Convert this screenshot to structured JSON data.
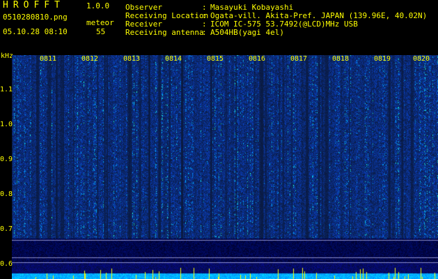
{
  "app": {
    "name": "HROFFT",
    "version": "1.0.0",
    "filename": "0510280810.png",
    "datetime": "05.10.28 08:10"
  },
  "meteor": {
    "label": "meteor",
    "count": "55"
  },
  "info": [
    {
      "label": "Observer",
      "value": "Masayuki Kobayashi"
    },
    {
      "label": "Receiving Location",
      "value": "Ogata-vill. Akita-Pref. JAPAN (139.96E, 40.02N)"
    },
    {
      "label": "Receiver",
      "value": "ICOM IC-575 53.7492(@LCD)MHz USB"
    },
    {
      "label": "Receiving antenna",
      "value": "A504HB(yagi 4el)"
    }
  ],
  "axis": {
    "unit": "kHz",
    "y_ticks": [
      "1.1",
      "1.0",
      "0.9",
      "0.8",
      "0.7",
      "0.6"
    ],
    "x_ticks": [
      "0811",
      "0812",
      "0813",
      "0814",
      "0815",
      "0816",
      "0817",
      "0818",
      "0819",
      "0820"
    ]
  },
  "colors": {
    "text": "#ffff00",
    "background": "#000000",
    "noise": "#1e3cc8",
    "signal": "#00ffff",
    "strong": "#ffff00"
  }
}
